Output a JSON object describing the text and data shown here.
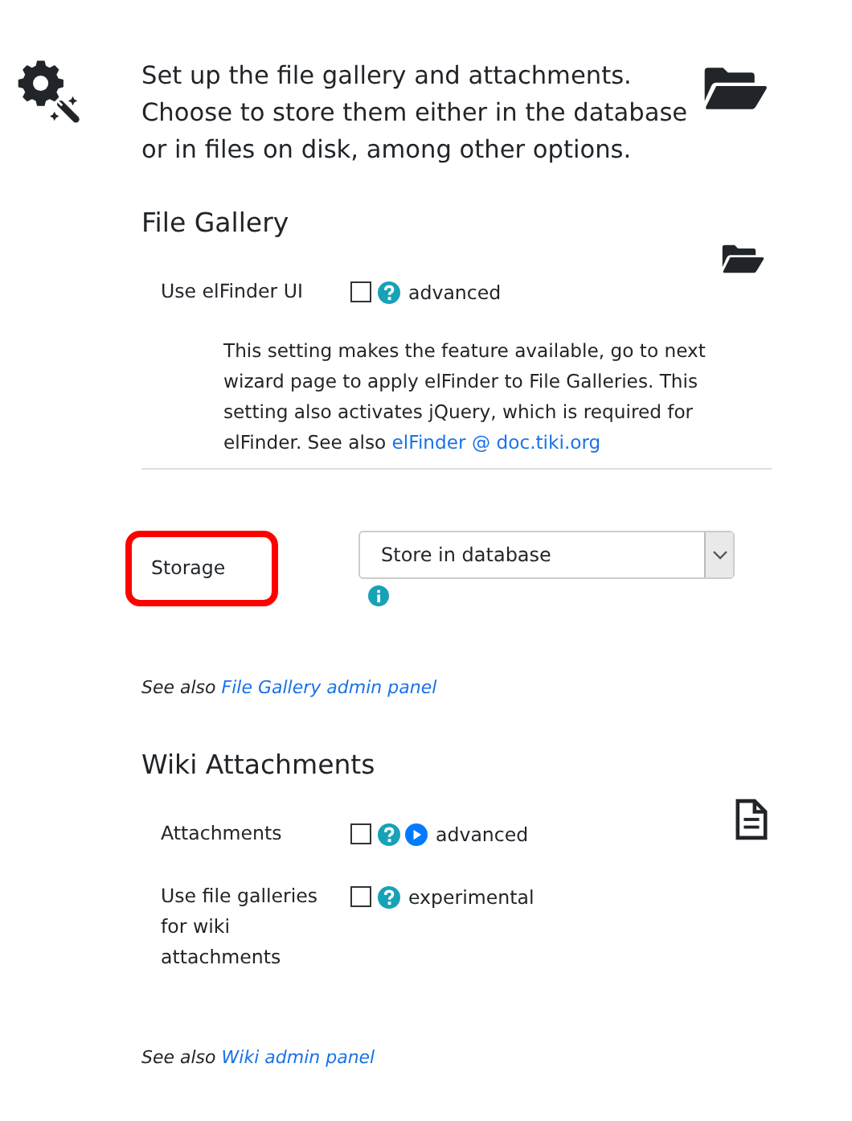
{
  "intro": {
    "text": "Set up the file gallery and attachments. Choose to store them either in the database or in files on disk, among other options."
  },
  "sections": [
    {
      "title": "File Gallery",
      "kind": "folder",
      "rows": [
        {
          "kind": "checkbox",
          "label": "Use elFinder UI",
          "checked": false,
          "icons": [
            {
              "kind": "help"
            }
          ],
          "tag": "advanced",
          "description": "This setting makes the feature available, go to next wizard page to apply elFinder to File Galleries. This setting also activates jQuery, which is required for elFinder. See also ",
          "link": "elFinder @ doc.tiki.org"
        },
        {
          "kind": "select",
          "label": "Storage",
          "highlighted": true,
          "value": "Store in database",
          "icons": [
            {
              "kind": "info"
            }
          ]
        }
      ],
      "see_also": {
        "text": "See also",
        "link": "File Gallery admin panel"
      }
    },
    {
      "title": "Wiki Attachments",
      "kind": "document",
      "rows": [
        {
          "kind": "checkbox",
          "label": "Attachments",
          "checked": false,
          "icons": [
            {
              "kind": "help"
            },
            {
              "kind": "play"
            }
          ],
          "tag": "advanced"
        },
        {
          "kind": "checkbox",
          "label": "Use file galleries for wiki attachments",
          "checked": false,
          "icons": [
            {
              "kind": "help"
            }
          ],
          "tag": "experimental"
        }
      ],
      "see_also": {
        "text": "See also",
        "link": "Wiki admin panel"
      }
    }
  ]
}
